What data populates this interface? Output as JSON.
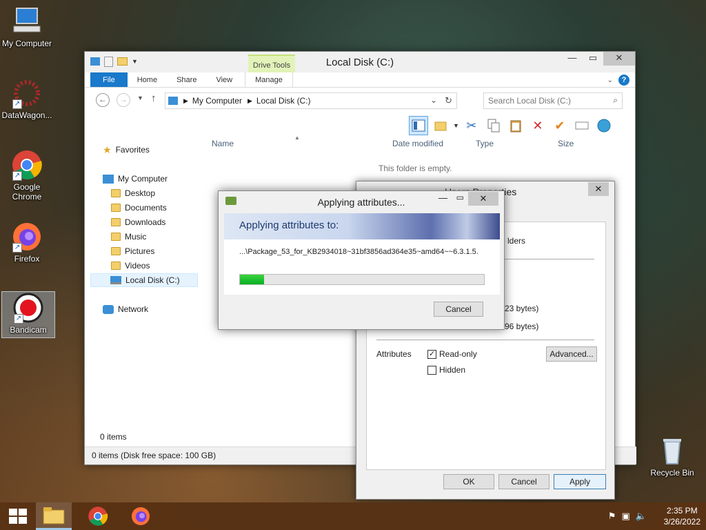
{
  "desktop": {
    "icons": [
      {
        "label": "My Computer"
      },
      {
        "label": "DataWagon..."
      },
      {
        "label": "Google Chrome"
      },
      {
        "label": "Firefox"
      },
      {
        "label": "Bandicam"
      },
      {
        "label": "Recycle Bin"
      }
    ]
  },
  "explorer": {
    "title": "Local Disk (C:)",
    "contextual_tab_group": "Drive Tools",
    "tabs": [
      "File",
      "Home",
      "Share",
      "View",
      "Manage"
    ],
    "address": {
      "root": "My Computer",
      "current": "Local Disk (C:)"
    },
    "search_placeholder": "Search Local Disk (C:)",
    "nav": {
      "favorites": "Favorites",
      "computer": "My Computer",
      "items": [
        "Desktop",
        "Documents",
        "Downloads",
        "Music",
        "Pictures",
        "Videos",
        "Local Disk (C:)"
      ],
      "network": "Network"
    },
    "columns": [
      "Name",
      "Date modified",
      "Type",
      "Size"
    ],
    "empty_message": "This folder is empty.",
    "item_count": "0 items",
    "status": "0 items (Disk free space: 100 GB)"
  },
  "properties_dialog": {
    "title_partial": "Users  Properties",
    "folders_fragment": "lders",
    "size_fragment_1": "23 bytes)",
    "size_fragment_2": "96 bytes)",
    "attributes_label": "Attributes",
    "readonly_label": "Read-only",
    "readonly_checked": true,
    "hidden_label": "Hidden",
    "hidden_checked": false,
    "advanced_button": "Advanced...",
    "ok_button": "OK",
    "cancel_button": "Cancel",
    "apply_button": "Apply"
  },
  "applying_dialog": {
    "title": "Applying attributes...",
    "banner": "Applying attributes to:",
    "path": "...\\Package_53_for_KB2934018~31bf3856ad364e35~amd64~~6.3.1.5.",
    "progress": 0.1,
    "cancel_button": "Cancel"
  },
  "taskbar": {
    "time": "2:35 PM",
    "date": "3/26/2022"
  },
  "colors": {
    "accent": "#1979ca",
    "progress": "#06b025",
    "taskbar": "#5a3214"
  }
}
